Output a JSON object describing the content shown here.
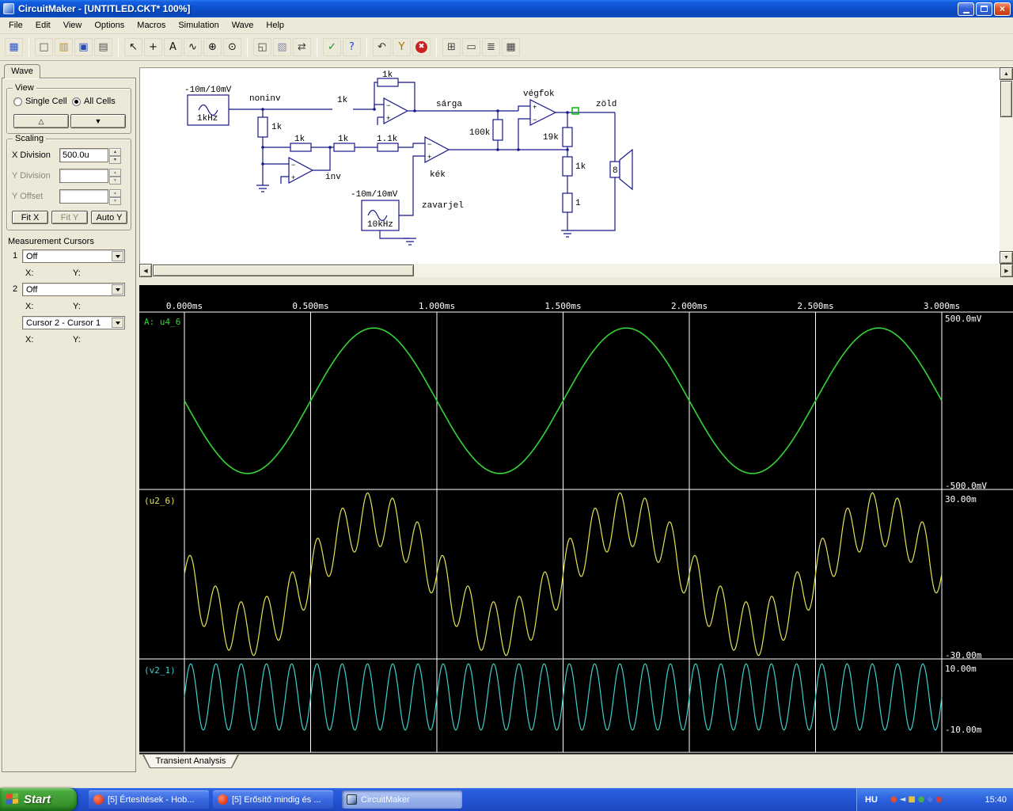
{
  "titlebar": {
    "title": "CircuitMaker - [UNTITLED.CKT* 100%]"
  },
  "menubar": {
    "items": [
      "File",
      "Edit",
      "View",
      "Options",
      "Macros",
      "Simulation",
      "Wave",
      "Help"
    ]
  },
  "toolbar": {
    "groups": [
      [
        {
          "name": "schematic-mode-button",
          "glyph": "▦",
          "color": "#3355bb"
        }
      ],
      [
        {
          "name": "new-file-button",
          "glyph": "□",
          "color": "#555555"
        },
        {
          "name": "open-file-button",
          "glyph": "▥",
          "color": "#c09020"
        },
        {
          "name": "save-button",
          "glyph": "▣",
          "color": "#2a4bb0"
        },
        {
          "name": "print-button",
          "glyph": "▤",
          "color": "#555555"
        }
      ],
      [
        {
          "name": "select-tool-button",
          "glyph": "↖",
          "color": "#111111"
        },
        {
          "name": "place-part-button",
          "glyph": "+",
          "color": "#111111"
        },
        {
          "name": "text-tool-button",
          "glyph": "A",
          "color": "#111111"
        },
        {
          "name": "wire-tool-button",
          "glyph": "∿",
          "color": "#111111"
        },
        {
          "name": "zoom-in-button",
          "glyph": "⊕",
          "color": "#111111"
        },
        {
          "name": "zoom-tool-button",
          "glyph": "⊙",
          "color": "#111111"
        }
      ],
      [
        {
          "name": "fit-page-button",
          "glyph": "◱",
          "color": "#444444"
        },
        {
          "name": "paste-button",
          "glyph": "▧",
          "color": "#8888aa"
        },
        {
          "name": "pan-button",
          "glyph": "⇄",
          "color": "#444444"
        }
      ],
      [
        {
          "name": "check-circuit-button",
          "glyph": "✓",
          "color": "#1a8a1a"
        },
        {
          "name": "help-button",
          "glyph": "?",
          "color": "#2244cc"
        }
      ],
      [
        {
          "name": "reset-button",
          "glyph": "↶",
          "color": "#333333"
        },
        {
          "name": "probe-button",
          "glyph": "Y",
          "color": "#997700"
        },
        {
          "name": "stop-button",
          "glyph": "✖",
          "color": "#ffffff"
        }
      ],
      [
        {
          "name": "export-wave-button",
          "glyph": "⊞",
          "color": "#444444"
        },
        {
          "name": "wave-single-button",
          "glyph": "▭",
          "color": "#444444"
        },
        {
          "name": "wave-multi-button",
          "glyph": "≣",
          "color": "#444444"
        },
        {
          "name": "wave-grid-button",
          "glyph": "▦",
          "color": "#444444"
        }
      ]
    ]
  },
  "sidebar": {
    "tab_label": "Wave",
    "view_group": {
      "title": "View",
      "single_cell": "Single Cell",
      "all_cells": "All Cells",
      "selected": "All Cells",
      "up_glyph": "△",
      "down_glyph": "▼"
    },
    "scaling_group": {
      "title": "Scaling",
      "x_label": "X Division",
      "x_value": "500.0u",
      "y_label": "Y Division",
      "y_value": "",
      "offset_label": "Y Offset",
      "offset_value": "",
      "fit_x": "Fit X",
      "fit_y": "Fit Y",
      "auto_y": "Auto Y"
    },
    "cursor_group": {
      "title": "Measurement Cursors",
      "c1_label": "1",
      "c1_value": "Off",
      "c2_label": "2",
      "c2_value": "Off",
      "diff_value": "Cursor 2 - Cursor 1",
      "x_label": "X:",
      "y_label": "Y:"
    }
  },
  "schematic": {
    "labels": {
      "src1_value": "-10m/10mV",
      "src1_freq": "1kHz",
      "noninv": "noninv",
      "r_series1": "1k",
      "r_shunt": "1k",
      "r_feedback1": "1k",
      "sarga": "sárga",
      "r_100k": "100k",
      "vegfok": "végfok",
      "zold": "zöld",
      "r_19k": "19k",
      "r_fb_1k": "1k",
      "r_1": "1",
      "speaker_impedance": "8",
      "r_inv_a": "1k",
      "r_inv_b": "1k",
      "r_1_1k": "1.1k",
      "inv": "inv",
      "kek": "kék",
      "src2_value": "-10m/10mV",
      "src2_freq": "10kHz",
      "zavarjel": "zavarjel"
    }
  },
  "waveform": {
    "tab_label": "Transient Analysis"
  },
  "chart_data": {
    "type": "line",
    "title": "Transient Analysis",
    "x_axis": {
      "unit": "ms",
      "tick_labels": [
        "0.000ms",
        "0.500ms",
        "1.000ms",
        "1.500ms",
        "2.000ms",
        "2.500ms",
        "3.000ms"
      ],
      "t_start_s": 0,
      "t_end_s": 0.003,
      "grid": true
    },
    "panels": [
      {
        "label": "A: u4_6",
        "color": "#35d435",
        "y_top_label": "500.0mV",
        "y_bottom_label": "-500.0mV",
        "y_max": 0.5,
        "signal": [
          {
            "freq_hz": 1000,
            "amplitude": 0.41,
            "phase_deg": 180
          }
        ]
      },
      {
        "label": "(u2_6)",
        "color": "#e6e352",
        "y_top_label": "30.00m",
        "y_bottom_label": "-30.00m",
        "y_max": 0.03,
        "signal": [
          {
            "freq_hz": 1000,
            "amplitude": 0.0195,
            "phase_deg": 180
          },
          {
            "freq_hz": 10000,
            "amplitude": 0.0095,
            "phase_deg": 0
          }
        ]
      },
      {
        "label": "(v2_1)",
        "color": "#3ecfcf",
        "y_top_label": "10.00m",
        "y_bottom_label": "-10.00m",
        "y_max": 0.01,
        "signal": [
          {
            "freq_hz": 10000,
            "amplitude": 0.0095,
            "phase_deg": 0
          }
        ]
      }
    ]
  },
  "taskbar": {
    "start_label": "Start",
    "tasks": [
      {
        "name": "task-button-ertesitesek",
        "label": "[5] Értesítések - Hob...",
        "active": false,
        "icon": "app"
      },
      {
        "name": "task-button-erosito",
        "label": "[5] Erősítő mindig és ...",
        "active": false,
        "icon": "app"
      },
      {
        "name": "task-button-circuitmaker",
        "label": "CircuitMaker",
        "active": true,
        "icon": "cm"
      }
    ],
    "tray": {
      "language": "HU",
      "time": "15:40",
      "icons": [
        {
          "name": "tray-icon-1",
          "glyph": "●",
          "color": "#e04f2f"
        },
        {
          "name": "volume-icon",
          "glyph": "◄",
          "color": "#d8dee8"
        },
        {
          "name": "tray-icon-3",
          "glyph": "■",
          "color": "#e8c23a"
        },
        {
          "name": "tray-icon-4",
          "glyph": "●",
          "color": "#46b048"
        },
        {
          "name": "tray-icon-5",
          "glyph": "◆",
          "color": "#5078e0"
        },
        {
          "name": "tray-icon-6",
          "glyph": "●",
          "color": "#d04040"
        }
      ]
    }
  }
}
